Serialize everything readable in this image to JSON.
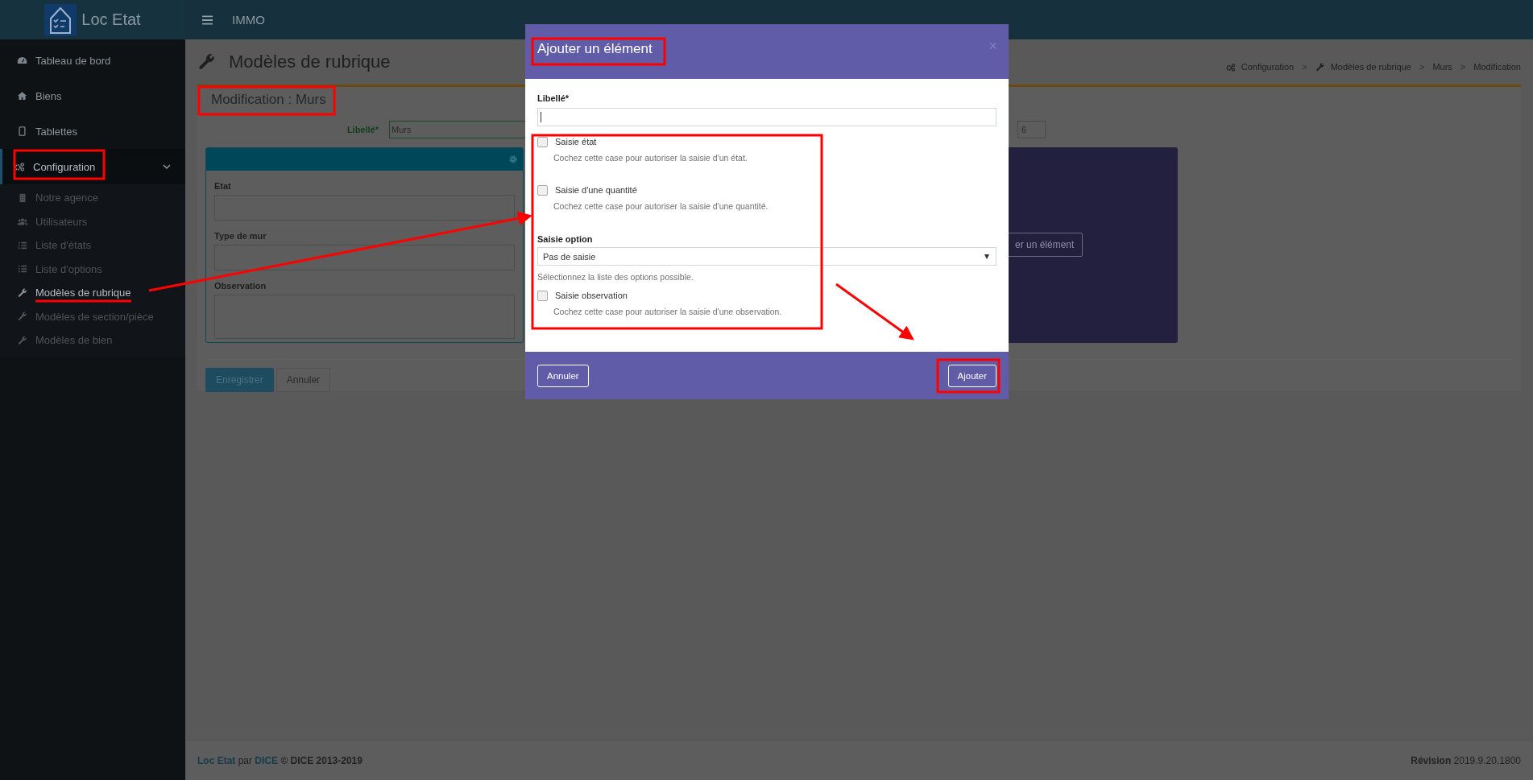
{
  "header": {
    "app_name": "Loc Etat",
    "section": "IMMO"
  },
  "sidebar": {
    "items": [
      {
        "label": "Tableau de bord",
        "selected": false
      },
      {
        "label": "Biens",
        "selected": false
      },
      {
        "label": "Tablettes",
        "selected": false
      },
      {
        "label": "Configuration",
        "selected": true,
        "expanded": true,
        "children": [
          {
            "label": "Notre agence",
            "selected": false
          },
          {
            "label": "Utilisateurs",
            "selected": false
          },
          {
            "label": "Liste d'états",
            "selected": false
          },
          {
            "label": "Liste d'options",
            "selected": false
          },
          {
            "label": "Modèles de rubrique",
            "selected": true
          },
          {
            "label": "Modèles de section/pièce",
            "selected": false
          },
          {
            "label": "Modèles de bien",
            "selected": false
          }
        ]
      }
    ]
  },
  "page": {
    "title": "Modèles de rubrique",
    "breadcrumb": [
      "Configuration",
      "Modèles de rubrique",
      "Murs",
      "Modification"
    ],
    "breadcrumb_separators": [
      ">",
      ">",
      ">"
    ],
    "box_title": "Modification : Murs",
    "libelle_label": "Libellé*",
    "libelle_value": "Murs",
    "order_value": "6",
    "card_fields": [
      {
        "label": "Etat",
        "kind": "input"
      },
      {
        "label": "Type de mur",
        "kind": "input"
      },
      {
        "label": "Observation",
        "kind": "textarea"
      }
    ],
    "add_button": "er un élément",
    "buttons": [
      "Enregistrer",
      "Annuler"
    ]
  },
  "modal": {
    "title": "Ajouter un élément",
    "close": "×",
    "libelle_label": "Libellé*",
    "checks": [
      {
        "label": "Saisie état",
        "help": "Cochez cette case pour autoriser la saisie d'un état.",
        "checked": false
      },
      {
        "label": "Saisie d'une quantité",
        "help": "Cochez cette case pour autoriser la saisie d'une quantité.",
        "checked": false
      }
    ],
    "option_label": "Saisie option",
    "option_value": "Pas de saisie",
    "option_help": "Sélectionnez la liste des options possible.",
    "observation": {
      "label": "Saisie observation",
      "help": "Cochez cette case pour autoriser la saisie d'une observation.",
      "checked": false
    },
    "cancel": "Annuler",
    "submit": "Ajouter"
  },
  "footer": {
    "app_link": "Loc Etat",
    "by": "par",
    "company_link": "DICE",
    "copyright": "© DICE 2013-2019",
    "revision": "**Révision** 2019.9.20.1800"
  }
}
